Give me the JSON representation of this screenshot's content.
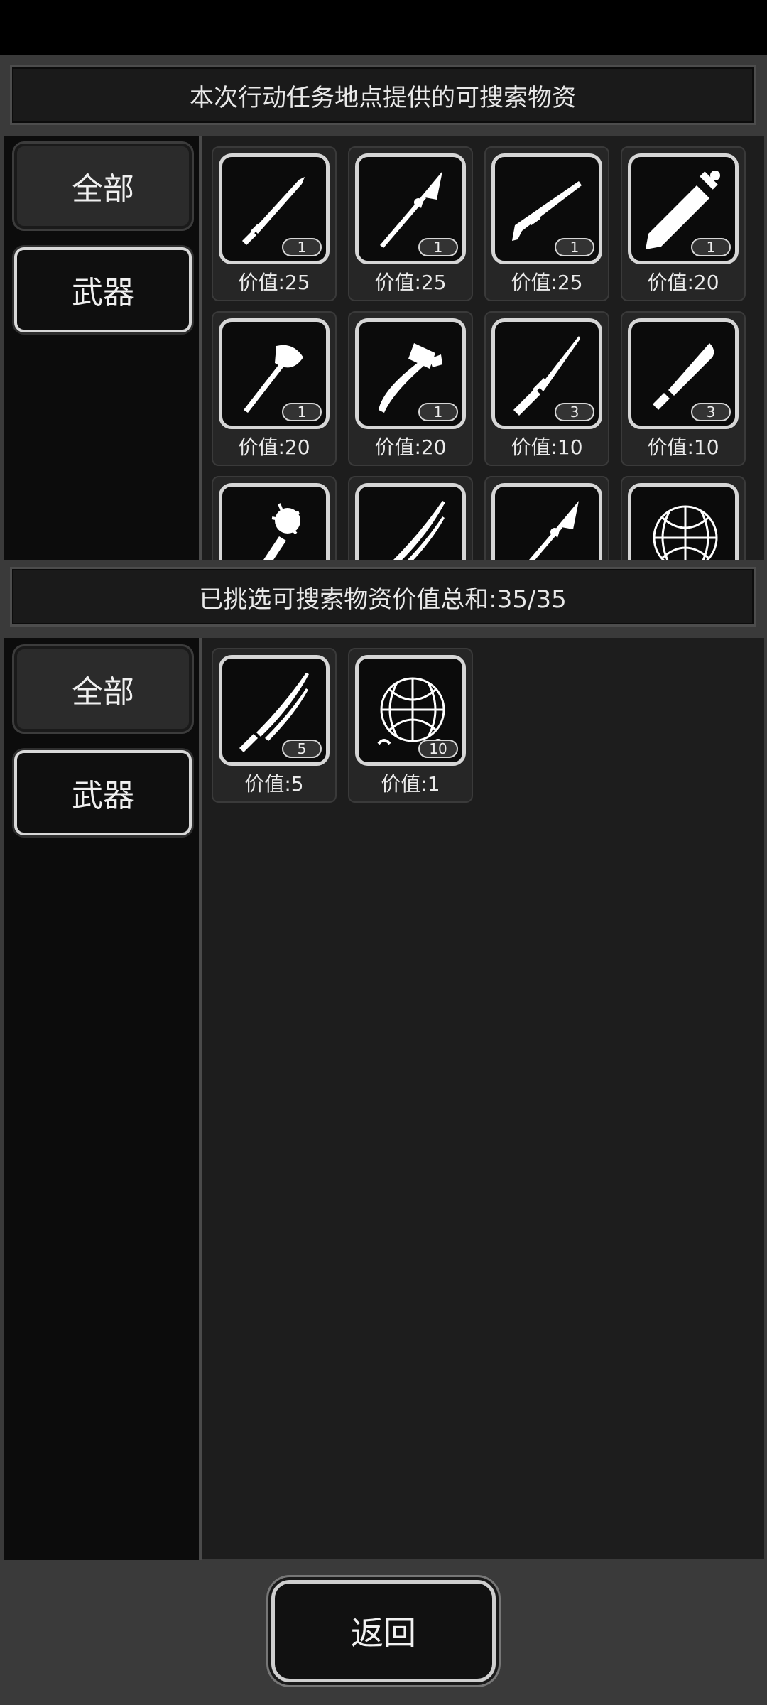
{
  "top_section": {
    "header": "本次行动任务地点提供的可搜索物资",
    "categories": [
      {
        "label": "全部",
        "active": true
      },
      {
        "label": "武器",
        "active": false
      }
    ],
    "items": [
      {
        "icon": "knife-icon",
        "qty": "1",
        "value": "价值:25"
      },
      {
        "icon": "spear-icon",
        "qty": "1",
        "value": "价值:25"
      },
      {
        "icon": "shotgun-icon",
        "qty": "1",
        "value": "价值:25"
      },
      {
        "icon": "broadsword-icon",
        "qty": "1",
        "value": "价值:20"
      },
      {
        "icon": "axe-icon",
        "qty": "1",
        "value": "价值:20"
      },
      {
        "icon": "hammer-axe-icon",
        "qty": "1",
        "value": "价值:20"
      },
      {
        "icon": "dagger-icon",
        "qty": "3",
        "value": "价值:10"
      },
      {
        "icon": "machete-icon",
        "qty": "3",
        "value": "价值:10"
      },
      {
        "icon": "spiked-club-icon",
        "qty": "",
        "value": ""
      },
      {
        "icon": "katana-icon",
        "qty": "",
        "value": ""
      },
      {
        "icon": "spear-icon",
        "qty": "",
        "value": ""
      },
      {
        "icon": "net-icon",
        "qty": "",
        "value": ""
      }
    ]
  },
  "bottom_section": {
    "header": "已挑选可搜索物资价值总和:35/35",
    "categories": [
      {
        "label": "全部",
        "active": true
      },
      {
        "label": "武器",
        "active": false
      }
    ],
    "items": [
      {
        "icon": "katana-icon",
        "qty": "5",
        "value": "价值:5"
      },
      {
        "icon": "net-icon",
        "qty": "10",
        "value": "价值:1"
      }
    ]
  },
  "footer": {
    "back_label": "返回"
  },
  "colors": {
    "background": "#1d1d1d",
    "frame": "#3a3a3a",
    "icon_border": "#d6d6d6"
  }
}
